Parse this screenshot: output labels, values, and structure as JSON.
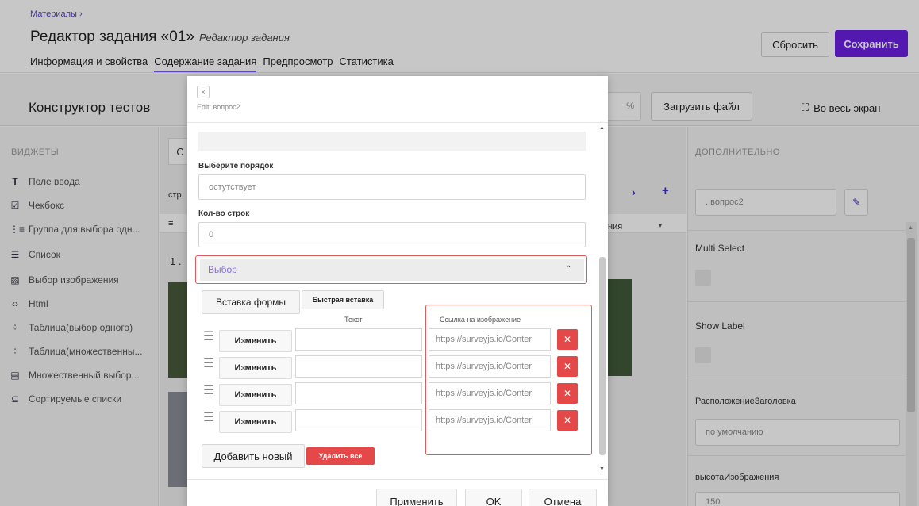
{
  "header": {
    "breadcrumb": "Материалы ›",
    "title": "Редактор задания «01»",
    "subtitle": "Редактор задания",
    "tabs": [
      "Информация и свойства",
      "Содержание задания",
      "Предпросмотр",
      "Статистика"
    ],
    "reset_label": "Сбросить",
    "save_label": "Сохранить"
  },
  "toolbar": {
    "title": "Конструктор тестов",
    "percent": "%",
    "upload_label": "Загрузить файл",
    "fullscreen_label": "Во весь экран"
  },
  "left_panel": {
    "title": "ВИДЖЕТЫ",
    "items": [
      {
        "label": "Поле ввода",
        "icon": "text-icon"
      },
      {
        "label": "Чекбокс",
        "icon": "checkbox-icon"
      },
      {
        "label": "Группа для выбора одн...",
        "icon": "radio-group-icon"
      },
      {
        "label": "Список",
        "icon": "list-icon"
      },
      {
        "label": "Выбор изображения",
        "icon": "image-icon"
      },
      {
        "label": "Html",
        "icon": "code-icon"
      },
      {
        "label": "Таблица(выбор одного)",
        "icon": "table-icon"
      },
      {
        "label": "Таблица(множественны...",
        "icon": "table-icon"
      },
      {
        "label": "Множественный выбор...",
        "icon": "multi-choice-icon"
      },
      {
        "label": "Сортируемые списки",
        "icon": "sort-list-icon"
      }
    ]
  },
  "center": {
    "fragments": [
      "С",
      "стр",
      "≡",
      "1 .",
      "ния"
    ]
  },
  "right_panel": {
    "title": "ДОПОЛНИТЕЛЬНО",
    "name_value": "..вопрос2",
    "multi_select_label": "Multi Select",
    "show_label_label": "Show Label",
    "title_location_label": "РасположениеЗаголовка",
    "title_location_value": "по умолчанию",
    "image_height_label": "высотаИзображения",
    "image_height_value": "150"
  },
  "modal": {
    "close_icon": "×",
    "edit_label": "Edit: вопрос2",
    "order_label": "Выберите порядок",
    "order_value": "остутствует",
    "rows_label": "Кол-во строк",
    "rows_value": "0",
    "choice_section": "Выбор",
    "form_insert_label": "Вставка формы",
    "quick_insert_label": "Быстрая вставка",
    "col_text": "Текст",
    "col_image_link": "Ссылка на изображение",
    "rows": [
      {
        "edit_label": "Изменить",
        "text": "",
        "url": "https://surveyjs.io/Conter"
      },
      {
        "edit_label": "Изменить",
        "text": "",
        "url": "https://surveyjs.io/Conter"
      },
      {
        "edit_label": "Изменить",
        "text": "",
        "url": "https://surveyjs.io/Conter"
      },
      {
        "edit_label": "Изменить",
        "text": "",
        "url": "https://surveyjs.io/Conter"
      }
    ],
    "add_new_label": "Добавить новый",
    "delete_all_label": "Удалить все",
    "apply_label": "Применить",
    "ok_label": "OK",
    "cancel_label": "Отмена"
  },
  "colors": {
    "accent": "#6a1fe0",
    "danger": "#e54848",
    "highlight_border": "#e05a5a"
  }
}
